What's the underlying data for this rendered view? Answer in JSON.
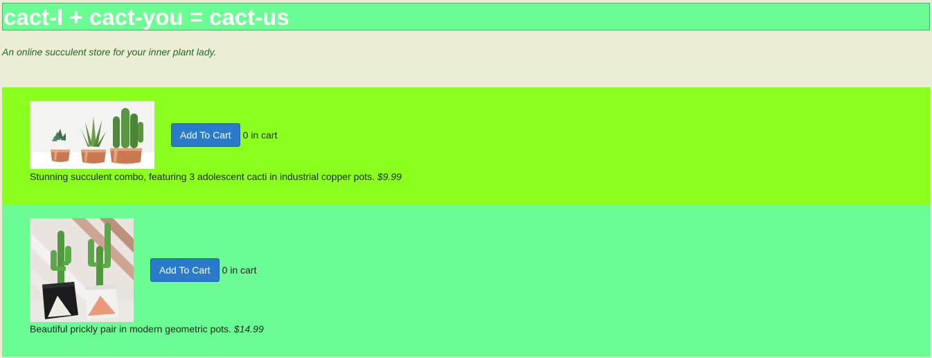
{
  "header": {
    "title": "cact-I + cact-you = cact-us"
  },
  "tagline": "An online succulent store for your inner plant lady.",
  "products": [
    {
      "image_alt": "Three cacti in copper pots",
      "add_button_label": "Add To Cart",
      "cart_count": "0 in cart",
      "description": "Stunning succulent combo, featuring 3 adolescent cacti in industrial copper pots.",
      "price": "$9.99",
      "background": "#8bff1d"
    },
    {
      "image_alt": "Two cacti in geometric pots",
      "add_button_label": "Add To Cart",
      "cart_count": "0 in cart",
      "description": "Beautiful prickly pair in modern geometric pots.",
      "price": "$14.99",
      "background": "#6cfc94"
    }
  ],
  "colors": {
    "page_background": "#ebeed4",
    "header_background": "#6cfc94",
    "button": "#2a7bc9",
    "tagline": "#1e6a1e"
  }
}
